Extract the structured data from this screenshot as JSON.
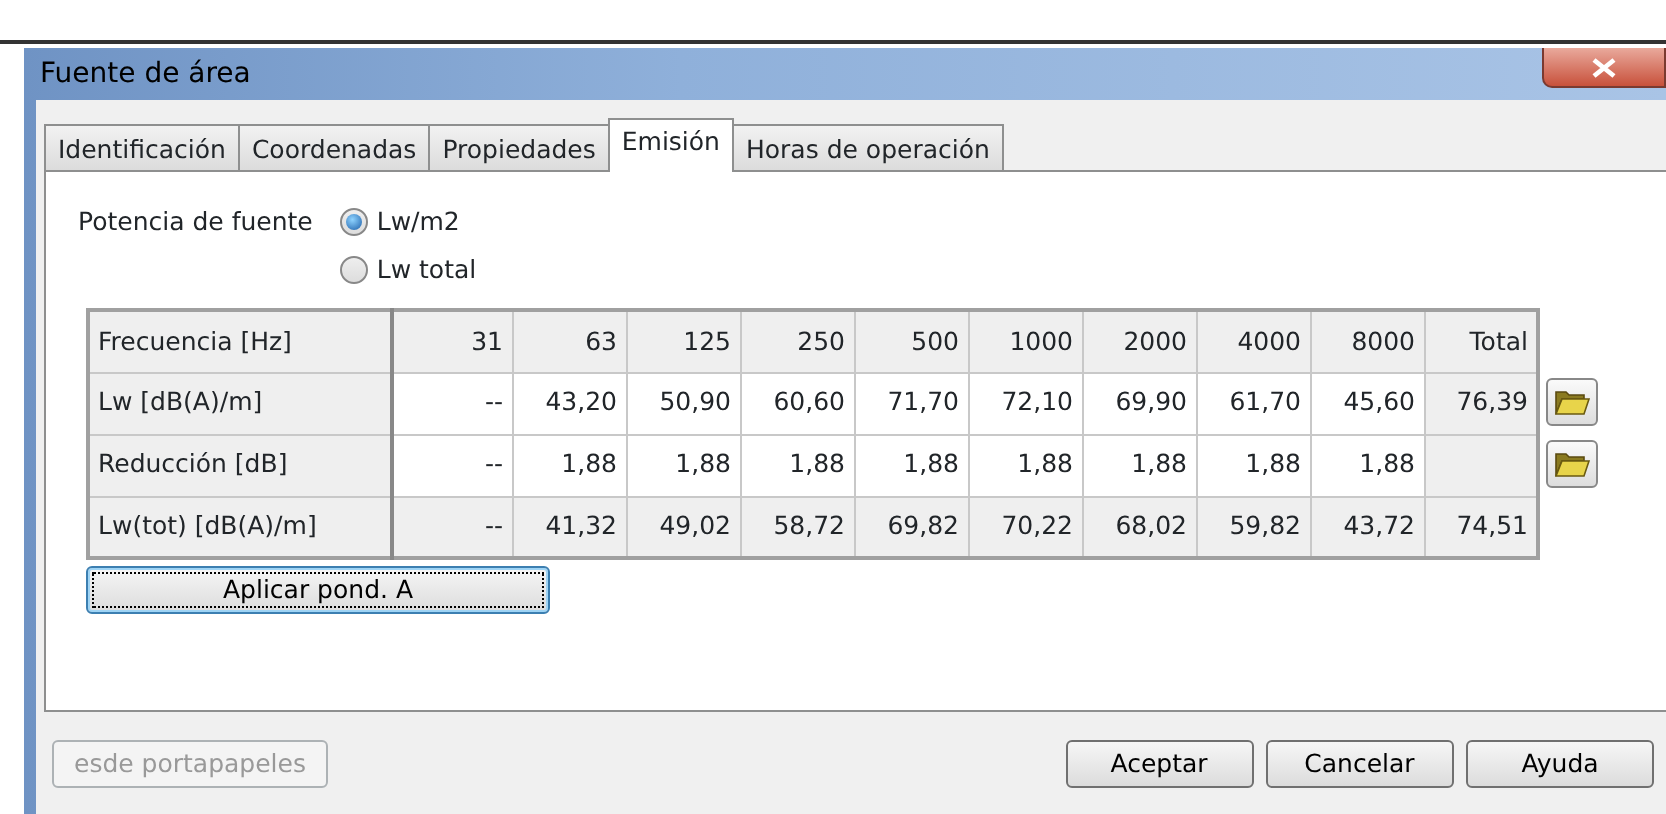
{
  "window": {
    "title": "Fuente de área"
  },
  "tabs": [
    {
      "label": "Identificación",
      "selected": false
    },
    {
      "label": "Coordenadas",
      "selected": false
    },
    {
      "label": "Propiedades",
      "selected": false
    },
    {
      "label": "Emisión",
      "selected": true
    },
    {
      "label": "Horas de operación",
      "selected": false
    }
  ],
  "source_power": {
    "label": "Potencia de fuente",
    "options": [
      {
        "label": "Lw/m2",
        "selected": true
      },
      {
        "label": "Lw total",
        "selected": false
      }
    ]
  },
  "table": {
    "columns": [
      "Frecuencia [Hz]",
      "31",
      "63",
      "125",
      "250",
      "500",
      "1000",
      "2000",
      "4000",
      "8000",
      "Total"
    ],
    "rows": [
      {
        "editable": true,
        "import_button": true,
        "cells": [
          "Lw [dB(A)/m]",
          "--",
          "43,20",
          "50,90",
          "60,60",
          "71,70",
          "72,10",
          "69,90",
          "61,70",
          "45,60",
          "76,39"
        ]
      },
      {
        "editable": true,
        "import_button": true,
        "cells": [
          "Reducción [dB]",
          "--",
          "1,88",
          "1,88",
          "1,88",
          "1,88",
          "1,88",
          "1,88",
          "1,88",
          "1,88",
          ""
        ]
      },
      {
        "editable": false,
        "import_button": false,
        "cells": [
          "Lw(tot) [dB(A)/m]",
          "--",
          "41,32",
          "49,02",
          "58,72",
          "69,82",
          "70,22",
          "68,02",
          "59,82",
          "43,72",
          "74,51"
        ]
      }
    ]
  },
  "apply_button": {
    "label": "Aplicar pond. A",
    "focused": true
  },
  "footer": {
    "clipboard_button": {
      "label": "esde portapapeles",
      "disabled": true
    },
    "buttons": [
      "Aceptar",
      "Cancelar",
      "Ayuda"
    ]
  }
}
